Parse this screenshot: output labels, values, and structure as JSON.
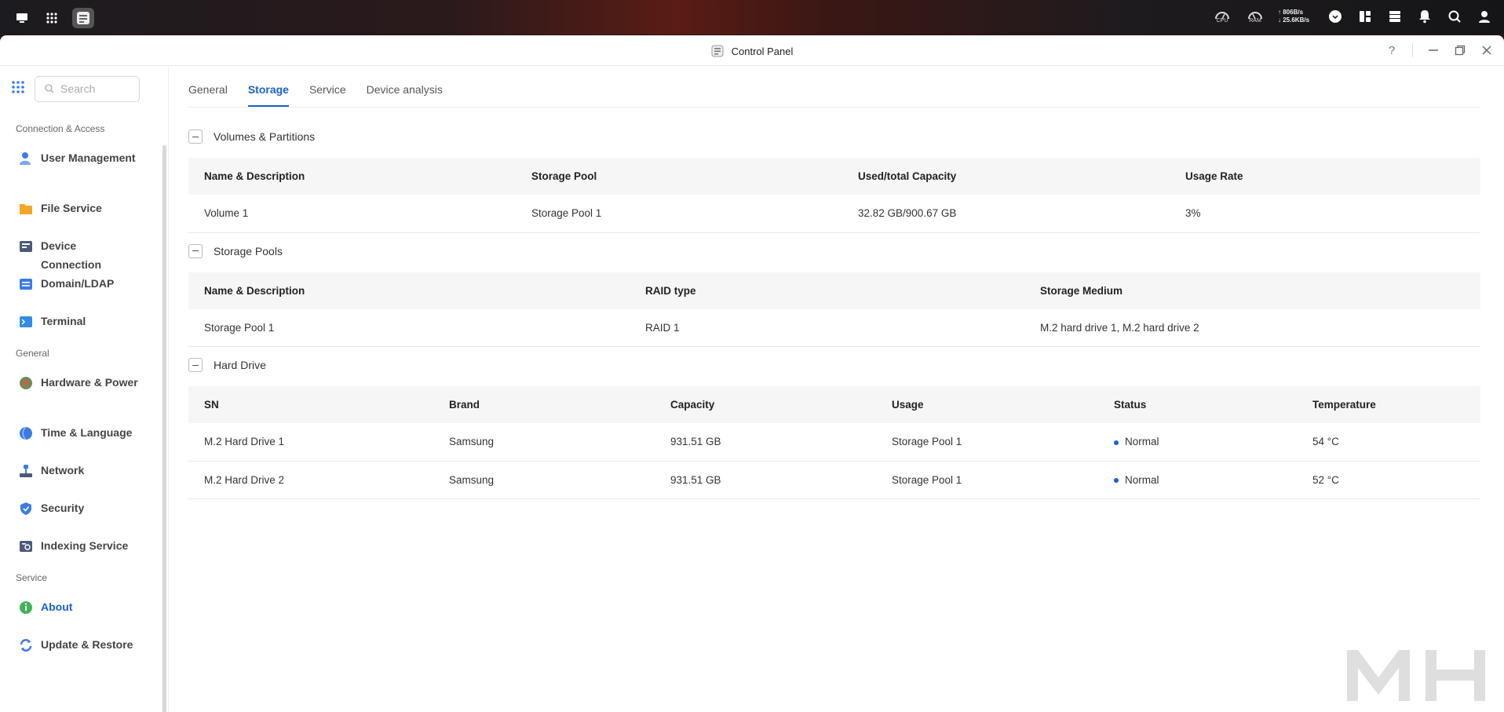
{
  "window": {
    "title": "Control Panel"
  },
  "taskbar": {
    "cpu_label": "CPU",
    "ram_label": "RAM",
    "net_up": "↑ 806B/s",
    "net_down": "↓ 25.6KB/s"
  },
  "sidebar": {
    "search_placeholder": "Search",
    "sections": [
      {
        "label": "Connection & Access"
      },
      {
        "label": "General"
      },
      {
        "label": "Service"
      }
    ],
    "items": [
      {
        "label": "User Management"
      },
      {
        "label": "File Service"
      },
      {
        "label": "Device Connection"
      },
      {
        "label": "Domain/LDAP"
      },
      {
        "label": "Terminal"
      },
      {
        "label": "Hardware & Power"
      },
      {
        "label": "Time & Language"
      },
      {
        "label": "Network"
      },
      {
        "label": "Security"
      },
      {
        "label": "Indexing Service"
      },
      {
        "label": "About"
      },
      {
        "label": "Update & Restore"
      }
    ]
  },
  "tabs": [
    {
      "label": "General"
    },
    {
      "label": "Storage"
    },
    {
      "label": "Service"
    },
    {
      "label": "Device analysis"
    }
  ],
  "volumes": {
    "title": "Volumes & Partitions",
    "headers": [
      "Name & Description",
      "Storage Pool",
      "Used/total Capacity",
      "Usage Rate"
    ],
    "rows": [
      [
        "Volume 1",
        "Storage Pool 1",
        "32.82 GB/900.67 GB",
        "3%"
      ]
    ]
  },
  "pools": {
    "title": "Storage Pools",
    "headers": [
      "Name & Description",
      "RAID type",
      "Storage Medium"
    ],
    "rows": [
      [
        "Storage Pool 1",
        "RAID 1",
        "M.2 hard drive 1, M.2 hard drive 2"
      ]
    ]
  },
  "drives": {
    "title": "Hard Drive",
    "headers": [
      "SN",
      "Brand",
      "Capacity",
      "Usage",
      "Status",
      "Temperature"
    ],
    "rows": [
      [
        "M.2 Hard Drive 1",
        "Samsung",
        "931.51 GB",
        "Storage Pool 1",
        "Normal",
        "54 °C"
      ],
      [
        "M.2 Hard Drive 2",
        "Samsung",
        "931.51 GB",
        "Storage Pool 1",
        "Normal",
        "52 °C"
      ]
    ]
  },
  "colors": {
    "accent": "#1a5fd6",
    "status_normal": "#1a5fd6"
  }
}
